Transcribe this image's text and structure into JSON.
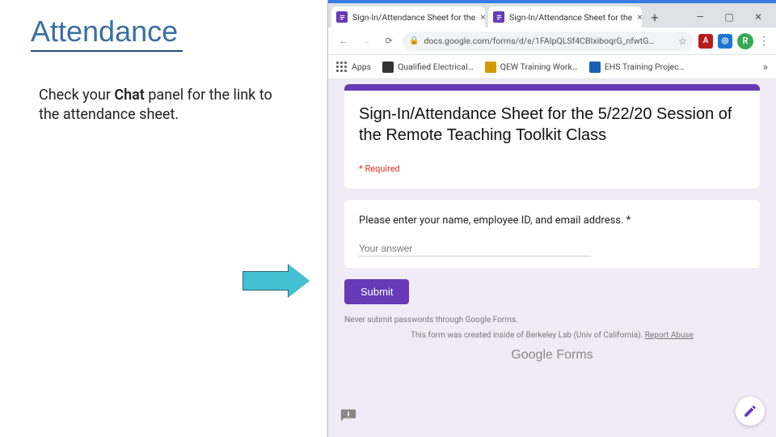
{
  "slide": {
    "title": "Attendance",
    "instruction_prefix": "Check your ",
    "instruction_bold": "Chat",
    "instruction_suffix": " panel for the link to the attendance sheet."
  },
  "browser": {
    "tabs": [
      {
        "label": "Sign-In/Attendance Sheet for the"
      },
      {
        "label": "Sign-In/Attendance Sheet for the"
      }
    ],
    "win": {
      "min": "—",
      "max": "▢",
      "close": "✕"
    },
    "newtab": "+",
    "toolbar": {
      "url": "docs.google.com/forms/d/e/1FAIpQLSf4CBIxiboqrG_nfwtG…",
      "avatar_initial": "R"
    },
    "bookmarks": {
      "apps": "Apps",
      "items": [
        {
          "label": "Qualified Electrical…",
          "color": "#333"
        },
        {
          "label": "QEW Training Work…",
          "color": "#d29a00"
        },
        {
          "label": "EHS Training Projec…",
          "color": "#1a5fb4"
        }
      ]
    }
  },
  "form": {
    "title": "Sign-In/Attendance Sheet for the 5/22/20 Session of the Remote Teaching Toolkit Class",
    "required_note": "* Required",
    "question": "Please enter your name, employee ID, and email address. *",
    "answer_placeholder": "Your answer",
    "submit": "Submit",
    "footer_warn": "Never submit passwords through Google Forms.",
    "footer_org": "This form was created inside of Berkeley Lab (Univ of California). ",
    "report": "Report Abuse",
    "logo_a": "Google",
    "logo_b": " Forms"
  }
}
